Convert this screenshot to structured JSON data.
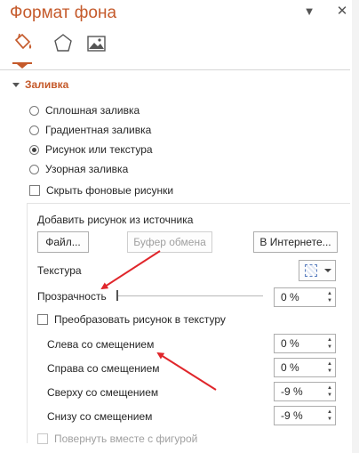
{
  "pane": {
    "title": "Формат фона",
    "dropdown_icon": "triangle-down-icon",
    "close_icon": "close-icon"
  },
  "tabs": [
    {
      "name": "fill-line",
      "icon": "paint-bucket-icon",
      "active": true
    },
    {
      "name": "effects",
      "icon": "pentagon-icon",
      "active": false
    },
    {
      "name": "picture",
      "icon": "picture-icon",
      "active": false
    }
  ],
  "fill": {
    "section_title": "Заливка",
    "options": [
      {
        "label": "Сплошная заливка",
        "selected": false
      },
      {
        "label": "Градиентная заливка",
        "selected": false
      },
      {
        "label": "Рисунок или текстура",
        "selected": true
      },
      {
        "label": "Узорная заливка",
        "selected": false
      }
    ],
    "hide_bg_label": "Скрыть фоновые рисунки",
    "insert_from_label": "Добавить рисунок из источника",
    "buttons": {
      "file": "Файл...",
      "clipboard": "Буфер обмена",
      "online": "В Интернете..."
    },
    "texture_label": "Текстура",
    "transparency_label": "Прозрачность",
    "transparency_value": "0 %",
    "transparency_fraction": 0,
    "tile_label": "Преобразовать рисунок в текстуру",
    "offsets": [
      {
        "label": "Слева со смещением",
        "value": "0 %"
      },
      {
        "label": "Справа со смещением",
        "value": "0 %"
      },
      {
        "label": "Сверху со смещением",
        "value": "-9 %"
      },
      {
        "label": "Снизу со смещением",
        "value": "-9 %"
      }
    ],
    "rotate_label": "Повернуть вместе с фигурой"
  },
  "colors": {
    "accent": "#c55a2b",
    "annotation_arrow": "#e0262b"
  }
}
